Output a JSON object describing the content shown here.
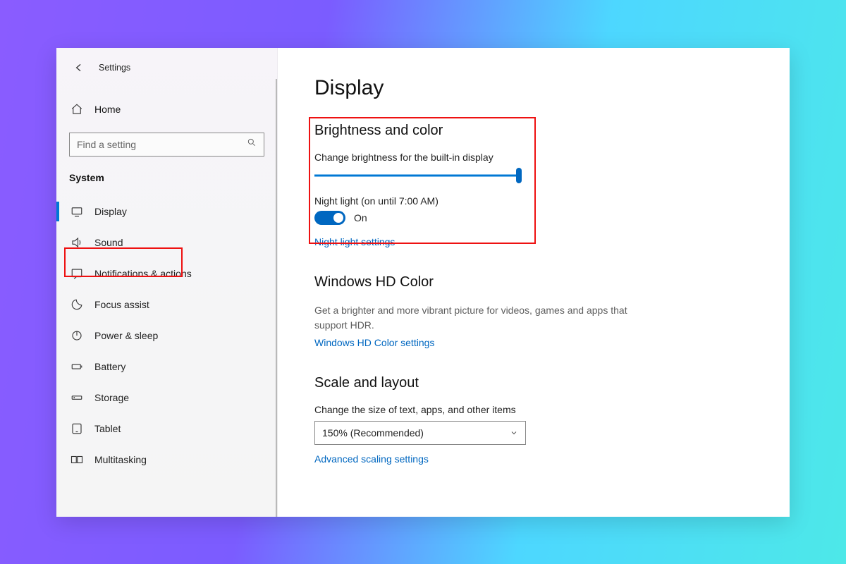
{
  "header": {
    "title": "Settings"
  },
  "home_label": "Home",
  "search": {
    "placeholder": "Find a setting"
  },
  "category_label": "System",
  "sidebar": {
    "items": [
      {
        "label": "Display"
      },
      {
        "label": "Sound"
      },
      {
        "label": "Notifications & actions"
      },
      {
        "label": "Focus assist"
      },
      {
        "label": "Power & sleep"
      },
      {
        "label": "Battery"
      },
      {
        "label": "Storage"
      },
      {
        "label": "Tablet"
      },
      {
        "label": "Multitasking"
      }
    ]
  },
  "page": {
    "title": "Display",
    "brightness": {
      "heading": "Brightness and color",
      "change_label": "Change brightness for the built-in display",
      "slider_percent": 100,
      "night_light_label": "Night light (on until 7:00 AM)",
      "toggle_state": "On",
      "night_light_settings_link": "Night light settings"
    },
    "hdcolor": {
      "heading": "Windows HD Color",
      "description": "Get a brighter and more vibrant picture for videos, games and apps that support HDR.",
      "link": "Windows HD Color settings"
    },
    "scale": {
      "heading": "Scale and layout",
      "change_label": "Change the size of text, apps, and other items",
      "selected": "150% (Recommended)",
      "advanced_link": "Advanced scaling settings"
    }
  }
}
